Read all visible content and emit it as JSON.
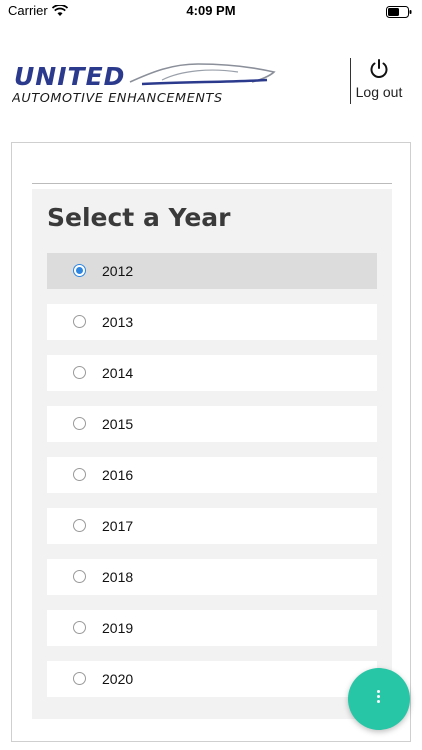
{
  "status_bar": {
    "carrier": "Carrier",
    "time": "4:09 PM",
    "wifi_icon": "wifi-icon",
    "battery_icon": "battery-icon"
  },
  "header": {
    "logo": {
      "line1": "UNITED",
      "line2": "AUTOMOTIVE ENHANCEMENTS",
      "brand_color": "#2b3a8c"
    },
    "logout": {
      "icon": "power-icon",
      "label": "Log out"
    }
  },
  "year_picker": {
    "title": "Select a Year",
    "selected": "2012",
    "accent_color": "#2f86e0",
    "years": [
      "2012",
      "2013",
      "2014",
      "2015",
      "2016",
      "2017",
      "2018",
      "2019",
      "2020"
    ]
  },
  "fab": {
    "icon": "more-vertical-icon",
    "color": "#26c6a6"
  }
}
